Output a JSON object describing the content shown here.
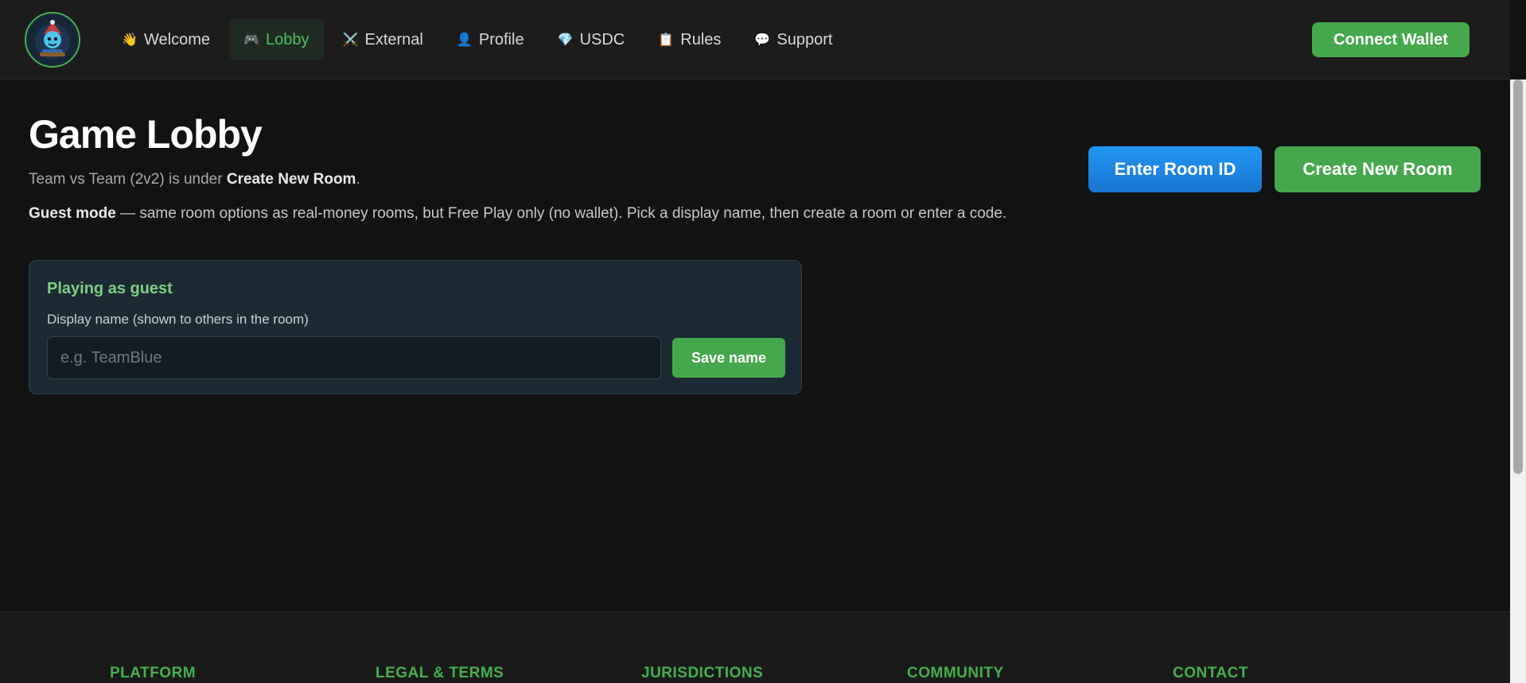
{
  "header": {
    "nav": [
      {
        "icon": "👋",
        "icon_name": "waving-hand-icon",
        "label": "Welcome",
        "active": false
      },
      {
        "icon": "🎮",
        "icon_name": "gamepad-icon",
        "label": "Lobby",
        "active": true
      },
      {
        "icon": "⚔️",
        "icon_name": "crossed-swords-icon",
        "label": "External",
        "active": false
      },
      {
        "icon": "👤",
        "icon_name": "user-icon",
        "label": "Profile",
        "active": false
      },
      {
        "icon": "💎",
        "icon_name": "gem-icon",
        "label": "USDC",
        "active": false
      },
      {
        "icon": "📋",
        "icon_name": "clipboard-icon",
        "label": "Rules",
        "active": false
      },
      {
        "icon": "💬",
        "icon_name": "speech-bubble-icon",
        "label": "Support",
        "active": false
      }
    ],
    "connect_wallet_label": "Connect Wallet"
  },
  "main": {
    "title": "Game Lobby",
    "subtitle_prefix": "Team vs Team (2v2) is under ",
    "subtitle_bold": "Create New Room",
    "subtitle_suffix": ".",
    "guest_bold": "Guest mode",
    "guest_text": " — same room options as real-money rooms, but Free Play only (no wallet). Pick a display name, then create a room or enter a code.",
    "enter_room_label": "Enter Room ID",
    "create_room_label": "Create New Room"
  },
  "guest_card": {
    "title": "Playing as guest",
    "label": "Display name (shown to others in the room)",
    "input_value": "",
    "input_placeholder": "e.g. TeamBlue",
    "save_label": "Save name"
  },
  "footer": {
    "columns": [
      "PLATFORM",
      "LEGAL & TERMS",
      "JURISDICTIONS",
      "COMMUNITY",
      "CONTACT"
    ]
  },
  "colors": {
    "accent_green": "#46a84c",
    "accent_blue": "#1e88e5",
    "background": "#121212"
  }
}
